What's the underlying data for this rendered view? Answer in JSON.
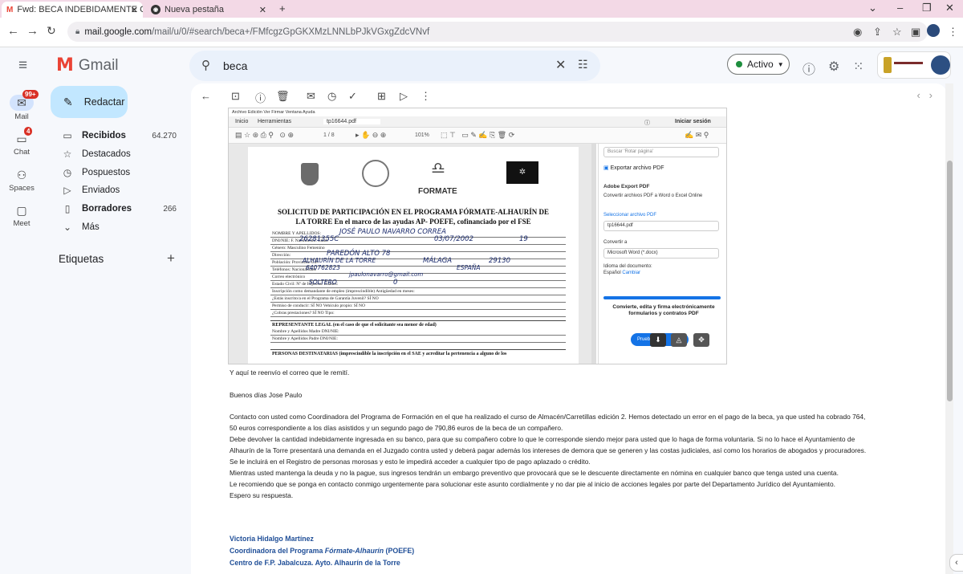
{
  "browser": {
    "tabs": [
      {
        "title": "Fwd: BECA INDEBIDAMENTE COI",
        "active": true
      },
      {
        "title": "Nueva pestaña",
        "active": false
      }
    ],
    "new_tab": "+",
    "url_host": "mail.google.com",
    "url_path": "/mail/u/0/#search/beca+/FMfcgzGpGKXMzLNNLbPJkVGxgZdcVNvf"
  },
  "gmail": {
    "app_name": "Gmail",
    "search_query": "beca",
    "status": "Activo",
    "rail": {
      "mail_label": "Mail",
      "mail_badge": "99+",
      "chat_label": "Chat",
      "chat_badge": "4",
      "spaces_label": "Spaces",
      "meet_label": "Meet"
    },
    "compose_label": "Redactar",
    "nav": [
      {
        "label": "Recibidos",
        "count": "64.270",
        "bold": true,
        "icon": "inbox-icon"
      },
      {
        "label": "Destacados",
        "count": "",
        "bold": false,
        "icon": "star-icon"
      },
      {
        "label": "Pospuestos",
        "count": "",
        "bold": false,
        "icon": "clock-icon"
      },
      {
        "label": "Enviados",
        "count": "",
        "bold": false,
        "icon": "send-icon"
      },
      {
        "label": "Borradores",
        "count": "266",
        "bold": true,
        "icon": "draft-icon"
      },
      {
        "label": "Más",
        "count": "",
        "bold": false,
        "icon": "chevron-down-icon"
      }
    ],
    "labels_heading": "Etiquetas",
    "labels_add": "+"
  },
  "pdf": {
    "menu": "Archivo  Edición  Ver  Firmar  Ventana  Ayuda",
    "tab_inicio": "Inicio",
    "tab_herramientas": "Herramientas",
    "tab_file": "tp16644.pdf",
    "signin": "Iniciar sesión",
    "page_indicator": "1 / 8",
    "zoom": "101%",
    "form_title_line1": "SOLICITUD DE PARTICIPACIÓN EN EL PROGRAMA FÓRMATE-ALHAURÍN DE",
    "form_title_line2": "LA TORRE En el marco de las ayudas AP- POEFE, cofinanciado por el FSE",
    "formate_logo": "FORMATE",
    "form_rows": [
      "NOMBRE Y APELLIDOS:",
      "DNI/NIE:                                         F. Nacimiento:                        Edad:",
      "Género:            Masculino              Femenino",
      "Dirección:",
      "Población:                                         Provincia:                              C.P.",
      "Teléfonos:                                                                  Nacionalidad:",
      "Correo electrónico",
      "Estado Civil:                                 Nº de Hijos/as:          Edades:",
      "Inscripción como demandante de empleo (imprescindible)      Antigüedad en meses:",
      "¿Estás inscrito/a en el Programa de Garantía Juvenil?         SÍ              NO",
      "Permiso de conducir:        SÍ           NO       Vehículo propio:          SÍ          NO",
      "¿Cobras prestaciones?       SÍ           NO       Tipo:"
    ],
    "handwriting": {
      "name": "JOSÉ PAULO   NAVARRO CORREA",
      "dni": "26281355C",
      "birth": "03/07/2002",
      "age": "19",
      "address": "PAREDÓN ALTO 78",
      "town": "ALHAURÍN DE LA TORRE",
      "province": "MÁLAGA",
      "cp": "29130",
      "phone": "640762823",
      "nationality": "ESPAÑA",
      "email": "jpaulonavarro@gmail.com",
      "civil": "SOLTERO",
      "children": "0"
    },
    "section_rep": "REPRESENTANTE LEGAL (en el caso de que el solicitante sea menor de edad)",
    "rep_rows": [
      "Nombre y Apellidos Madre                                                                        DNI/NIE:",
      "Nombre y Apellidos Padre                                                                         DNI/NIE:"
    ],
    "section_dest": "PERSONAS DESTINATARIAS (imprescindible la inscripción en el SAE y acreditar la pertenencia a alguno de los",
    "right_panel": {
      "search_placeholder": "Buscar 'Rotar página'",
      "export_title": "Exportar archivo PDF",
      "adobe_export": "Adobe Export PDF",
      "convert_desc": "Convertir archivos PDF a Word o Excel Online",
      "select_file": "Seleccionar archivo PDF",
      "file_name": "tp16644.pdf",
      "convert_to": "Convertir a",
      "format": "Microsoft Word (*.docx)",
      "doc_lang": "Idioma del documento:",
      "lang_value": "Español",
      "lang_change": "Cambiar",
      "banner": "Convierte, edita y firma electrónicamente formularios y contratos PDF",
      "button": "Prueba"
    }
  },
  "email": {
    "lines": [
      "Y aquí te reenvío el correo que le remití.",
      "Buenos días Jose Paulo",
      "Contacto con usted como Coordinadora del Programa de Formación en el que ha realizado el curso de Almacén/Carretillas edición 2. Hemos detectado un error en el pago de la beca, ya que usted ha cobrado 764,",
      "50 euros  correspondiente a los días asistidos y un segundo pago de 790,86 euros de la beca de un compañero.",
      "Debe devolver la cantidad indebidamente ingresada en su banco, para que su compañero cobre lo que le corresponde siendo mejor para usted que lo haga de forma voluntaria. Si no lo hace el Ayuntamiento de",
      "Alhaurín de la Torre presentará una demanda en el Juzgado contra usted y deberá pagar además los intereses de demora que se generen y las costas judiciales, así como los horarios de abogados y procuradores.",
      "Se le incluirá en el Registro de personas morosas y esto le impedirá acceder a cualquier tipo de pago aplazado o crédito.",
      "Mientras usted mantenga la deuda y no la pague, sus ingresos tendrán un embargo preventivo que provocará que se le descuente directamente en nómina en cualquier banco que tenga usted una cuenta.",
      "Le recomiendo que se ponga en contacto conmigo urgentemente para solucionar este asunto cordialmente y no dar pie al inicio de acciones legales por parte del Departamento Jurídico del Ayuntamiento.",
      "Espero su respuesta."
    ],
    "signature": {
      "name": "Victoria Hidalgo Martínez",
      "role_prefix": "Coordinadora del Programa ",
      "role_program": "Fórmate-Alhaurín",
      "role_suffix": " (POEFE)",
      "center": "Centro de F.P. Jabalcuza. Ayto. Alhaurín de la Torre"
    }
  }
}
